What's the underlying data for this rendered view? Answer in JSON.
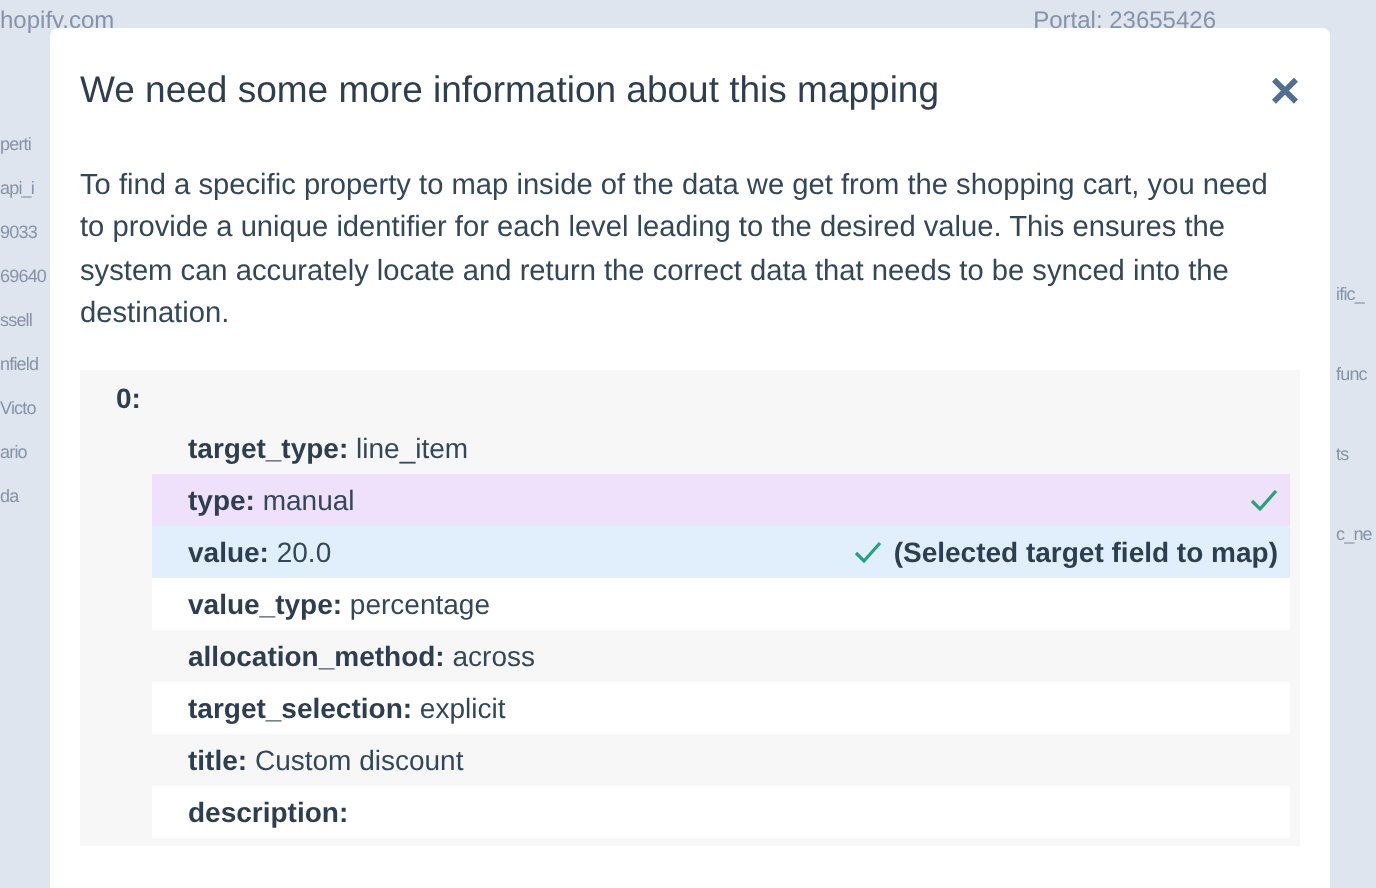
{
  "background": {
    "header_left": "hopify.com",
    "header_right": "Portal: 23655426",
    "left_fragments": [
      "perti",
      "api_i",
      "9033",
      "69640",
      "ssell",
      "nfield",
      "Victo",
      "ario",
      "da"
    ],
    "right_fragments": [
      "ific_",
      "func",
      "ts",
      "c_ne"
    ]
  },
  "dialog": {
    "title": "We need some more information about this mapping",
    "close": "×",
    "description": "To find a specific property to map inside of the data we get from the shopping cart, you need to provide a unique identifier for each level leading to the desired value. This ensures the system can accurately locate and return the correct data that needs to be synced into the destination.",
    "data": {
      "index": "0:",
      "fields": [
        {
          "key": "target_type:",
          "value": "line_item",
          "checked": false,
          "selected": false
        },
        {
          "key": "type:",
          "value": "manual",
          "checked": true,
          "selected": false
        },
        {
          "key": "value:",
          "value": "20.0",
          "checked": true,
          "selected": true,
          "note": "(Selected target field to map)"
        },
        {
          "key": "value_type:",
          "value": "percentage",
          "checked": false,
          "selected": false
        },
        {
          "key": "allocation_method:",
          "value": "across",
          "checked": false,
          "selected": false
        },
        {
          "key": "target_selection:",
          "value": "explicit",
          "checked": false,
          "selected": false
        },
        {
          "key": "title:",
          "value": "Custom discount",
          "checked": false,
          "selected": false
        },
        {
          "key": "description:",
          "checked": false,
          "selected": false
        }
      ]
    }
  }
}
